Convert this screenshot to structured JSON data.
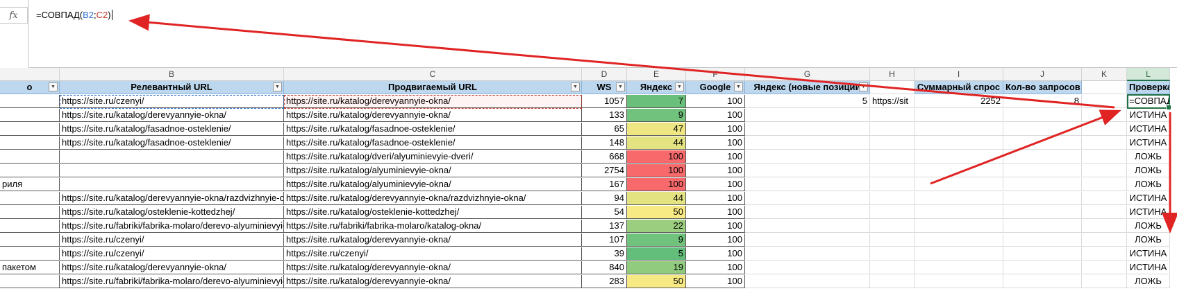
{
  "formula_bar": {
    "fx_label": "fx",
    "formula_prefix": "=СОВПАД(",
    "ref1": "B2",
    "sep": ";",
    "ref2": "C2",
    "formula_suffix": ")"
  },
  "columns": [
    "",
    "B",
    "C",
    "D",
    "E",
    "F",
    "G",
    "H",
    "I",
    "J",
    "K",
    "L"
  ],
  "headers": [
    "о",
    "Релевантный URL",
    "Продвигаемый URL",
    "WS",
    "Яндекс",
    "Google",
    "Яндекс (новые позиции",
    "",
    "Суммарный спрос",
    "Кол-во запросов",
    "",
    "Проверка совпад"
  ],
  "rows": [
    {
      "a": "",
      "b": "https://site.ru/czenyi/",
      "c": "https://site.ru/katalog/derevyannyie-okna/",
      "d": "1057",
      "e": "7",
      "f": "100",
      "g": "5",
      "h": "https://sit",
      "i": "2252",
      "j": "8",
      "l": "=СОВПАД"
    },
    {
      "a": "",
      "b": "https://site.ru/katalog/derevyannyie-okna/",
      "c": "https://site.ru/katalog/derevyannyie-okna/",
      "d": "133",
      "e": "9",
      "f": "100",
      "l": "ИСТИНА"
    },
    {
      "a": "",
      "b": "https://site.ru/katalog/fasadnoe-osteklenie/",
      "c": "https://site.ru/katalog/fasadnoe-osteklenie/",
      "d": "65",
      "e": "47",
      "f": "100",
      "l": "ИСТИНА"
    },
    {
      "a": "",
      "b": "https://site.ru/katalog/fasadnoe-osteklenie/",
      "c": "https://site.ru/katalog/fasadnoe-osteklenie/",
      "d": "148",
      "e": "44",
      "f": "100",
      "l": "ИСТИНА"
    },
    {
      "a": "",
      "b": "",
      "c": "https://site.ru/katalog/dveri/alyuminievyie-dveri/",
      "d": "668",
      "e": "100",
      "f": "100",
      "l": "ЛОЖЬ"
    },
    {
      "a": "",
      "b": "",
      "c": "https://site.ru/katalog/alyuminievyie-okna/",
      "d": "2754",
      "e": "100",
      "f": "100",
      "l": "ЛОЖЬ"
    },
    {
      "a": "риля",
      "b": "",
      "c": "https://site.ru/katalog/alyuminievyie-okna/",
      "d": "167",
      "e": "100",
      "f": "100",
      "l": "ЛОЖЬ"
    },
    {
      "a": "",
      "b": "https://site.ru/katalog/derevyannyie-okna/razdvizhnyie-okna/",
      "c": "https://site.ru/katalog/derevyannyie-okna/razdvizhnyie-okna/",
      "d": "94",
      "e": "44",
      "f": "100",
      "l": "ИСТИНА"
    },
    {
      "a": "",
      "b": "https://site.ru/katalog/osteklenie-kottedzhej/",
      "c": "https://site.ru/katalog/osteklenie-kottedzhej/",
      "d": "54",
      "e": "50",
      "f": "100",
      "l": "ИСТИНА"
    },
    {
      "a": "",
      "b": "https://site.ru/fabriki/fabrika-molaro/derevo-alyuminievyie-okna/",
      "c": "https://site.ru/fabriki/fabrika-molaro/katalog-okna/",
      "d": "137",
      "e": "22",
      "f": "100",
      "l": "ЛОЖЬ"
    },
    {
      "a": "",
      "b": "https://site.ru/czenyi/",
      "c": "https://site.ru/katalog/derevyannyie-okna/",
      "d": "107",
      "e": "9",
      "f": "100",
      "l": "ЛОЖЬ"
    },
    {
      "a": "",
      "b": "https://site.ru/czenyi/",
      "c": "https://site.ru/czenyi/",
      "d": "39",
      "e": "5",
      "f": "100",
      "l": "ИСТИНА"
    },
    {
      "a": "пакетом",
      "b": "https://site.ru/katalog/derevyannyie-okna/",
      "c": "https://site.ru/katalog/derevyannyie-okna/",
      "d": "840",
      "e": "19",
      "f": "100",
      "l": "ИСТИНА"
    },
    {
      "a": "",
      "b": "https://site.ru/fabriki/fabrika-molaro/derevo-alyuminievyie-okna/",
      "c": "https://site.ru/katalog/derevyannyie-okna/",
      "d": "283",
      "e": "50",
      "f": "100",
      "l": "ЛОЖЬ"
    }
  ],
  "colors": {
    "accent": "#217346",
    "header_fill": "#bdd7ee",
    "arrow": "#e02424",
    "scale_low": "#63be7b",
    "scale_mid": "#ffeb84",
    "scale_high": "#f8696b"
  }
}
